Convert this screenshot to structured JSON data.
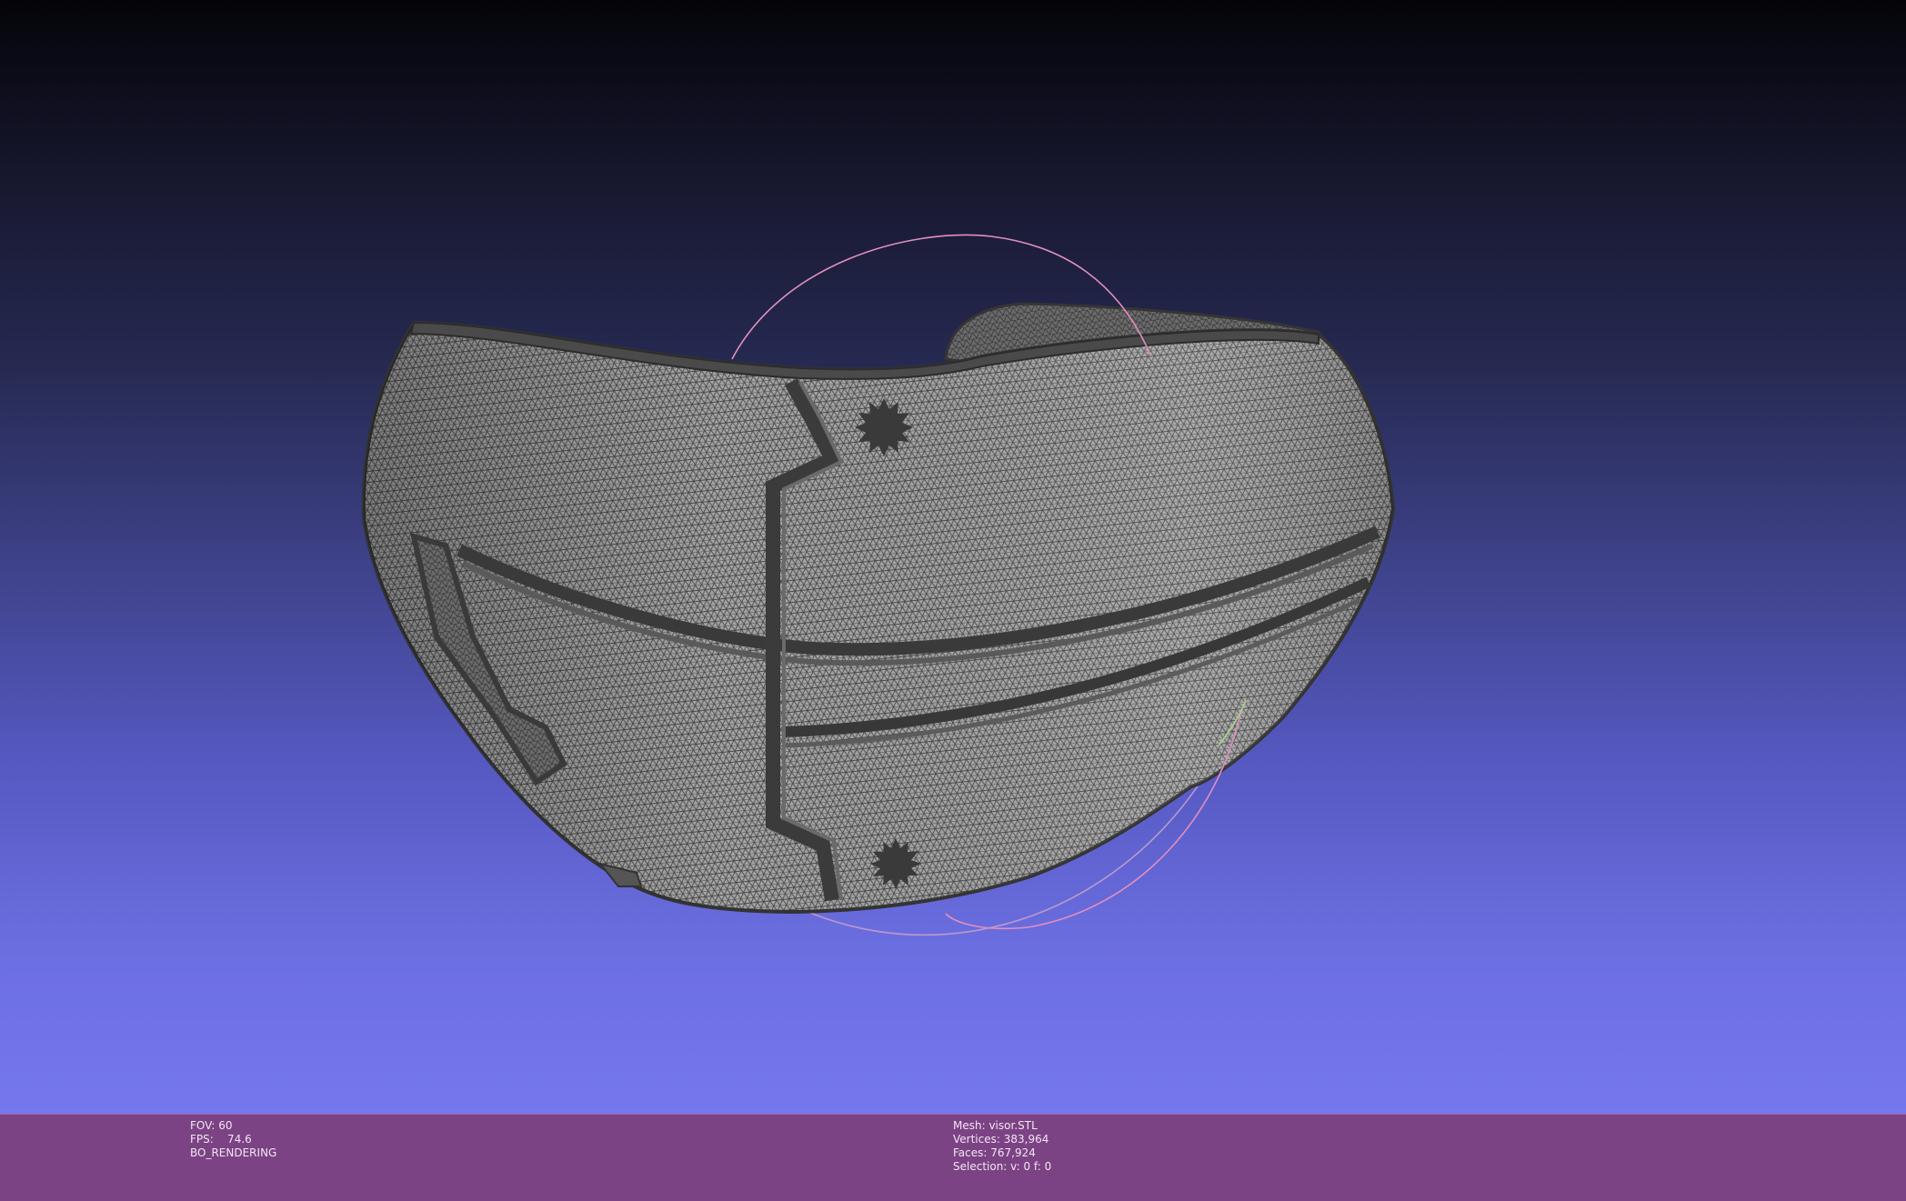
{
  "viewer": {
    "mesh_color": "#9d9d9d",
    "wire_color": "#3f3f3f",
    "background_top": "#040409",
    "background_bottom": "#7577ec",
    "trackball": {
      "ring_1_color": "#b99acb",
      "ring_2_color": "#e28fbf",
      "ring_3_color": "#a7d08a"
    }
  },
  "status": {
    "left": {
      "fov": "FOV: 60",
      "fps": "FPS:    74.6",
      "mode": "BO_RENDERING"
    },
    "right": {
      "mesh": "Mesh: visor.STL",
      "vertices": "Vertices: 383,964",
      "faces": "Faces: 767,924",
      "selection": "Selection: v: 0 f: 0"
    },
    "bar_color": "#7c4384"
  }
}
